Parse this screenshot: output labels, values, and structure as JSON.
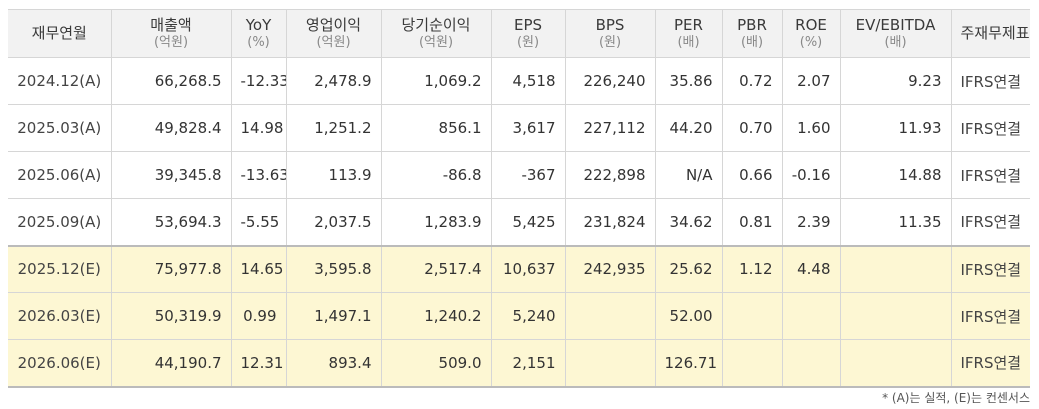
{
  "columns": [
    {
      "label": "재무연월",
      "unit": ""
    },
    {
      "label": "매출액",
      "unit": "(억원)"
    },
    {
      "label": "YoY",
      "unit": "(%)"
    },
    {
      "label": "영업이익",
      "unit": "(억원)"
    },
    {
      "label": "당기순이익",
      "unit": "(억원)"
    },
    {
      "label": "EPS",
      "unit": "(원)"
    },
    {
      "label": "BPS",
      "unit": "(원)"
    },
    {
      "label": "PER",
      "unit": "(배)"
    },
    {
      "label": "PBR",
      "unit": "(배)"
    },
    {
      "label": "ROE",
      "unit": "(%)"
    },
    {
      "label": "EV/EBITDA",
      "unit": "(배)"
    },
    {
      "label": "주재무제표",
      "unit": ""
    }
  ],
  "rows": [
    {
      "estimate": false,
      "cells": [
        "2024.12(A)",
        "66,268.5",
        "-12.33",
        "2,478.9",
        "1,069.2",
        "4,518",
        "226,240",
        "35.86",
        "0.72",
        "2.07",
        "9.23",
        "IFRS연결"
      ]
    },
    {
      "estimate": false,
      "cells": [
        "2025.03(A)",
        "49,828.4",
        "14.98",
        "1,251.2",
        "856.1",
        "3,617",
        "227,112",
        "44.20",
        "0.70",
        "1.60",
        "11.93",
        "IFRS연결"
      ]
    },
    {
      "estimate": false,
      "cells": [
        "2025.06(A)",
        "39,345.8",
        "-13.63",
        "113.9",
        "-86.8",
        "-367",
        "222,898",
        "N/A",
        "0.66",
        "-0.16",
        "14.88",
        "IFRS연결"
      ]
    },
    {
      "estimate": false,
      "cells": [
        "2025.09(A)",
        "53,694.3",
        "-5.55",
        "2,037.5",
        "1,283.9",
        "5,425",
        "231,824",
        "34.62",
        "0.81",
        "2.39",
        "11.35",
        "IFRS연결"
      ]
    },
    {
      "estimate": true,
      "cells": [
        "2025.12(E)",
        "75,977.8",
        "14.65",
        "3,595.8",
        "2,517.4",
        "10,637",
        "242,935",
        "25.62",
        "1.12",
        "4.48",
        "",
        "IFRS연결"
      ]
    },
    {
      "estimate": true,
      "cells": [
        "2026.03(E)",
        "50,319.9",
        "0.99",
        "1,497.1",
        "1,240.2",
        "5,240",
        "",
        "52.00",
        "",
        "",
        "",
        "IFRS연결"
      ]
    },
    {
      "estimate": true,
      "cells": [
        "2026.06(E)",
        "44,190.7",
        "12.31",
        "893.4",
        "509.0",
        "2,151",
        "",
        "126.71",
        "",
        "",
        "",
        "IFRS연결"
      ]
    }
  ],
  "footnote": "* (A)는 실적, (E)는 컨센서스"
}
